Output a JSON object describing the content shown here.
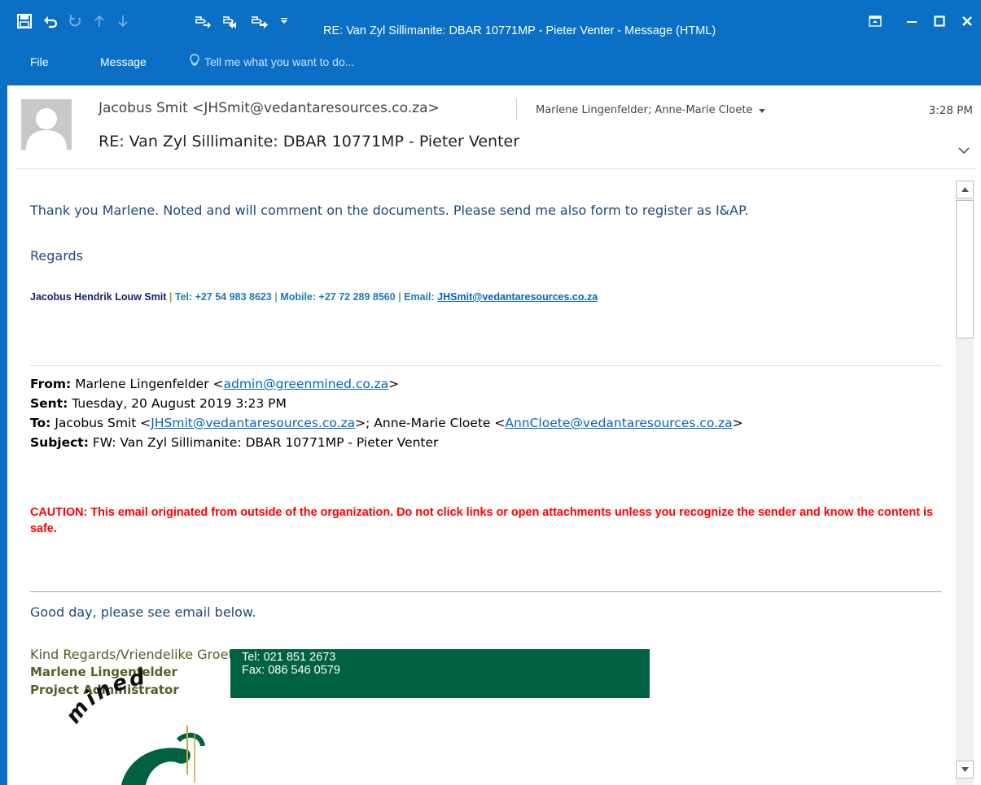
{
  "window": {
    "title": "RE: Van Zyl Sillimanite: DBAR 10771MP - Pieter Venter - Message (HTML)"
  },
  "ribbon": {
    "tabs": [
      "File",
      "Message"
    ],
    "tell_me": "Tell me what you want to do..."
  },
  "header": {
    "from": "Jacobus Smit <JHSmit@vedantaresources.co.za>",
    "recipients": "Marlene Lingenfelder; Anne-Marie Cloete",
    "time": "3:28 PM",
    "subject": "RE: Van Zyl Sillimanite: DBAR 10771MP - Pieter Venter"
  },
  "reply": {
    "text": "Thank you Marlene. Noted and will comment on the documents. Please send me also form to register as I&AP.",
    "regards": "Regards",
    "signature": {
      "name": "Jacobus Hendrik Louw Smit",
      "sep": "|",
      "tel": "Tel: +27 54 983 8623",
      "mobile": "Mobile: +27 72 289 8560",
      "email_label": "Email:",
      "email": "JHSmit@vedantaresources.co.za"
    }
  },
  "forward_meta": {
    "from_label": "From:",
    "from_name": "Marlene Lingenfelder <",
    "from_email": "admin@greenmined.co.za",
    "from_close": ">",
    "sent_label": "Sent:",
    "sent": "Tuesday, 20 August 2019 3:23 PM",
    "to_label": "To:",
    "to_name1": "Jacobus Smit <",
    "to_email1": "JHSmit@vedantaresources.co.za",
    "to_mid": ">; Anne-Marie Cloete <",
    "to_email2": "AnnCloete@vedantaresources.co.za",
    "to_close": ">",
    "subject_label": "Subject:",
    "subject": "FW: Van Zyl Sillimanite: DBAR 10771MP - Pieter Venter"
  },
  "caution": "CAUTION: This email originated from outside of the organization. Do not click links or open attachments unless you recognize the sender and know the content is safe.",
  "forwarded": {
    "greeting": "Good day, please see email below.",
    "closing": "Kind Regards/Vriendelike Groete",
    "name": "Marlene Lingenfelder",
    "role": "Project Administrator",
    "logo_text": "mined",
    "tel": "Tel: 021 851 2673",
    "fax": "Fax: 086 546 0579"
  },
  "colors": {
    "accent": "#0b6fc5",
    "body_blue": "#1f497d",
    "link": "#0563c1",
    "caution": "#ff0000",
    "signature_green": "#4f6228",
    "contact_green": "#006241"
  },
  "icons": [
    "save-icon",
    "undo-icon",
    "redo-icon",
    "up-arrow-icon",
    "down-arrow-icon",
    "reply-icon",
    "reply-all-icon",
    "forward-icon",
    "customize-icon",
    "ribbon-display-icon",
    "minimize-icon",
    "maximize-icon",
    "close-icon",
    "lightbulb-icon",
    "chevron-down-icon",
    "scroll-up-icon",
    "scroll-down-icon"
  ]
}
